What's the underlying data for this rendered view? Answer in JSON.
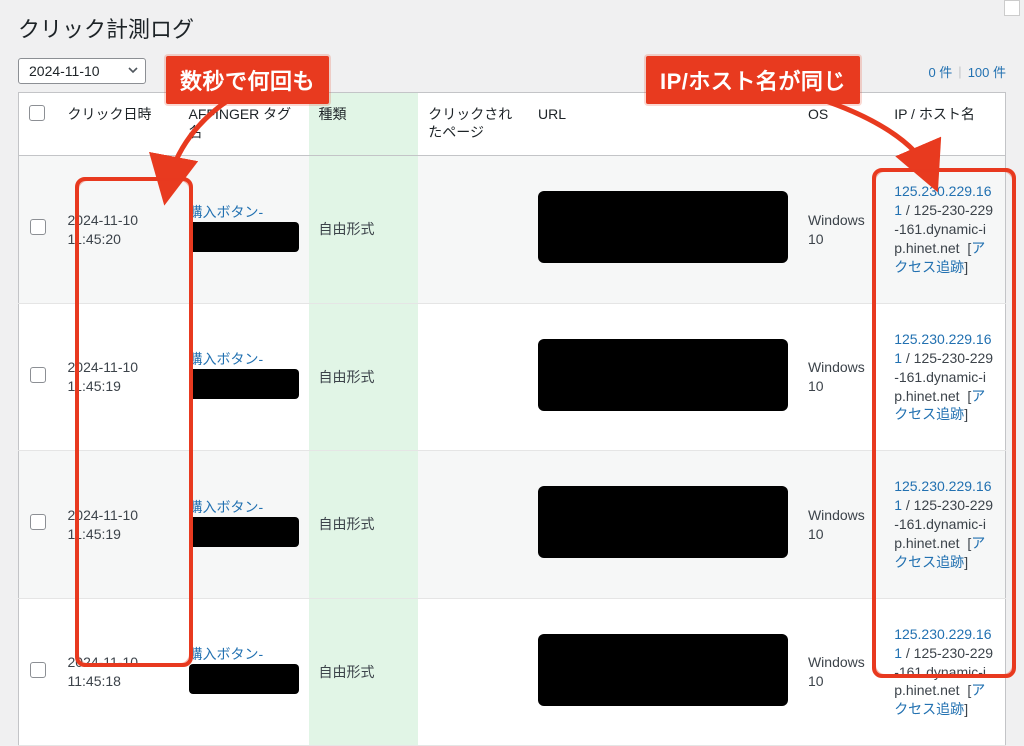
{
  "page_title": "クリック計測ログ",
  "date_filter": {
    "selected": "2024-11-10"
  },
  "count_links": {
    "fifty": "0 件",
    "hundred": "100 件"
  },
  "columns": {
    "check": "",
    "click_at": "クリック日時",
    "tag_name": "AFFINGER タグ名",
    "type": "種類",
    "clicked_page": "クリックされたページ",
    "url": "URL",
    "os": "OS",
    "ip_host": "IP / ホスト名"
  },
  "rows": [
    {
      "click_at": "2024-11-10 11:45:20",
      "tag_link": "購入ボタン-",
      "type": "自由形式",
      "os": "Windows 10",
      "ip": "125.230.229.161",
      "host": "125-230-229-161.dynamic-ip.hinet.net",
      "access_link": "アクセス追跡"
    },
    {
      "click_at": "2024-11-10 11:45:19",
      "tag_link": "購入ボタン-",
      "type": "自由形式",
      "os": "Windows 10",
      "ip": "125.230.229.161",
      "host": "125-230-229-161.dynamic-ip.hinet.net",
      "access_link": "アクセス追跡"
    },
    {
      "click_at": "2024-11-10 11:45:19",
      "tag_link": "購入ボタン-",
      "type": "自由形式",
      "os": "Windows 10",
      "ip": "125.230.229.161",
      "host": "125-230-229-161.dynamic-ip.hinet.net",
      "access_link": "アクセス追跡"
    },
    {
      "click_at": "2024-11-10 11:45:18",
      "tag_link": "購入ボタン-",
      "type": "自由形式",
      "os": "Windows 10",
      "ip": "125.230.229.161",
      "host": "125-230-229-161.dynamic-ip.hinet.net",
      "access_link": "アクセス追跡"
    }
  ],
  "annotations": {
    "left_callout": "数秒で何回も",
    "right_callout": "IP/ホスト名が同じ"
  }
}
